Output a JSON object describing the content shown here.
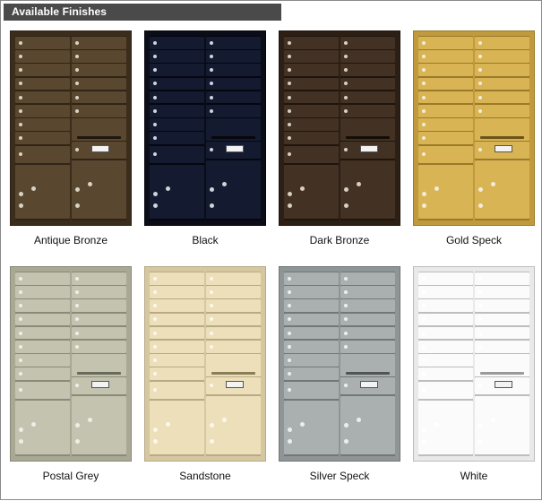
{
  "header": {
    "title": "Available Finishes"
  },
  "finishes": [
    {
      "name": "Antique Bronze",
      "body": "#4e3d27",
      "door": "#5a472f",
      "edge": "#2f2416",
      "lock": "#d9d3c4",
      "slot": "#1e170e",
      "frame": "#3a2d1c"
    },
    {
      "name": "Black",
      "body": "#0f1424",
      "door": "#141a30",
      "edge": "#05070e",
      "lock": "#cfd3da",
      "slot": "#05070d",
      "frame": "#0a0d18"
    },
    {
      "name": "Dark Bronze",
      "body": "#3a2a1d",
      "door": "#433124",
      "edge": "#1f150d",
      "lock": "#d7cfc2",
      "slot": "#140d07",
      "frame": "#2c1f15"
    },
    {
      "name": "Gold Speck",
      "body": "#cfa94a",
      "door": "#d8b454",
      "edge": "#9a7a2b",
      "lock": "#f2ecd8",
      "slot": "#6b5418",
      "frame": "#c09a3c"
    },
    {
      "name": "Postal Grey",
      "body": "#b8b8a4",
      "door": "#c3c3b0",
      "edge": "#8a8a78",
      "lock": "#eeeee6",
      "slot": "#6a6a5a",
      "frame": "#a8a895"
    },
    {
      "name": "Sandstone",
      "body": "#e3d7b2",
      "door": "#ecdfba",
      "edge": "#b8aa85",
      "lock": "#fbf7ea",
      "slot": "#8a7d58",
      "frame": "#d5c8a1"
    },
    {
      "name": "Silver Speck",
      "body": "#9ea3a3",
      "door": "#aab0b0",
      "edge": "#727777",
      "lock": "#eceeee",
      "slot": "#4f5454",
      "frame": "#8f9494"
    },
    {
      "name": "White",
      "body": "#f5f5f5",
      "door": "#fbfbfb",
      "edge": "#bdbdbd",
      "lock": "#ffffff",
      "slot": "#9a9a9a",
      "frame": "#e9e9e9"
    }
  ]
}
